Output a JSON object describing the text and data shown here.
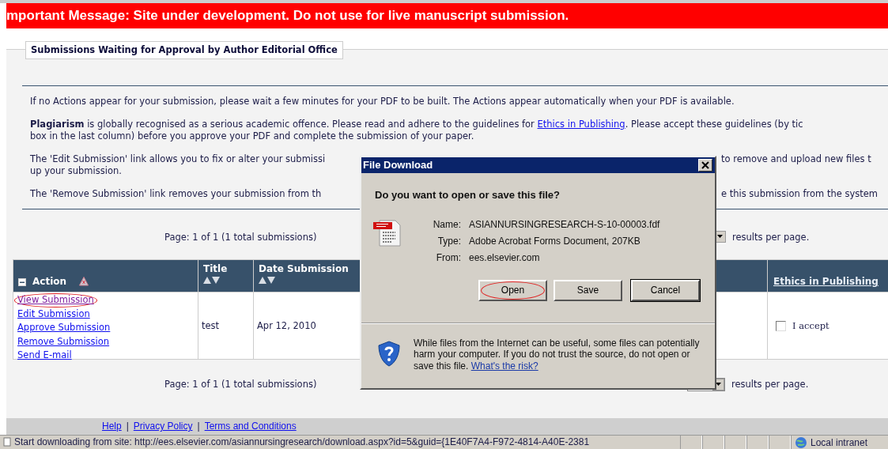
{
  "banner": {
    "text": "mportant Message: Site under development. Do not use for live manuscript submission."
  },
  "section": {
    "title": "Submissions Waiting for Approval by Author Editorial Office"
  },
  "notes": [
    {
      "lines": [
        {
          "left": [
            {
              "text": "If no Actions appear for your submission, please wait a few minutes for your PDF to be built. The Actions appear automatically when your PDF is available."
            }
          ]
        }
      ]
    },
    {
      "lines": [
        {
          "left": [
            {
              "text": "**Plagiarism** is globally recognised as a serious academic offence. Please read and adhere to the guidelines for "
            },
            {
              "link": "Ethics in Publishing"
            },
            {
              "text": ". Please accept these guidelines (by tic"
            }
          ]
        },
        {
          "left": [
            {
              "text": "box in the last column) before you approve your PDF and complete the submission of your paper."
            }
          ]
        }
      ]
    },
    {
      "lines": [
        {
          "left": [
            {
              "text": "The 'Edit Submission' link allows you to fix or alter your submissi"
            }
          ],
          "right": [
            {
              "text": "to remove and upload new files t"
            }
          ]
        },
        {
          "left": [
            {
              "text": "up your submission."
            }
          ]
        }
      ]
    },
    {
      "lines": [
        {
          "left": [
            {
              "text": "The 'Remove Submission' link removes your submission from th"
            }
          ],
          "right": [
            {
              "text": "e this submission from the system"
            }
          ]
        }
      ]
    }
  ],
  "pagers": [
    {
      "text": "Page: 1 of 1 (1 total submissions)",
      "suffix": "results per page."
    },
    {
      "text": "Page: 1 of 1 (1 total submissions)",
      "suffix": "results per page."
    }
  ],
  "table": {
    "columns": [
      {
        "kind": "action",
        "label": "Action"
      },
      {
        "kind": "sortable",
        "label": "Title"
      },
      {
        "kind": "sortable",
        "label": "Date Submission"
      },
      {
        "kind": "covered"
      },
      {
        "kind": "link",
        "label": "Ethics in Publishing"
      }
    ],
    "rows": [
      {
        "actions": [
          {
            "label": "View Submission",
            "circled": true
          },
          {
            "label": "Edit Submission",
            "circled": false
          },
          {
            "label": "Approve Submission",
            "circled": false
          },
          {
            "label": "Remove Submission",
            "circled": false
          },
          {
            "label": "Send E-mail",
            "circled": false
          }
        ],
        "title": "test",
        "date": "Apr 12, 2010",
        "ethics": {
          "label": "I accept",
          "checked": false
        }
      }
    ]
  },
  "footer": [
    {
      "kind": "link",
      "text": "Help"
    },
    {
      "kind": "separator",
      "text": "|"
    },
    {
      "kind": "link",
      "text": "Privacy Policy"
    },
    {
      "kind": "separator",
      "text": "|"
    },
    {
      "kind": "link",
      "text": "Terms and Conditions"
    }
  ],
  "status_bar": {
    "text": "Start downloading from site: http://ees.elsevier.com/asiannursingresearch/download.aspx?id=5&guid={1E40F7A4-F972-4814-A40E-2381",
    "zone": "Local intranet"
  },
  "dialog": {
    "title": "File Download",
    "question": "Do you want to open or save this file?",
    "fields": [
      {
        "label": "Name:",
        "value": "ASIANNURSINGRESEARCH-S-10-00003.fdf"
      },
      {
        "label": "Type:",
        "value": "Adobe Acrobat Forms Document, 207KB"
      },
      {
        "label": "From:",
        "value": "ees.elsevier.com"
      }
    ],
    "buttons": [
      {
        "label": "Open",
        "circled": true,
        "default": false
      },
      {
        "label": "Save",
        "circled": false,
        "default": false
      },
      {
        "label": "Cancel",
        "circled": false,
        "default": true
      }
    ],
    "warning": "While files from the Internet can be useful, some files can potentially harm your computer. If you do not trust the source, do not open or save this file. ",
    "warning_link": "What's the risk?"
  }
}
